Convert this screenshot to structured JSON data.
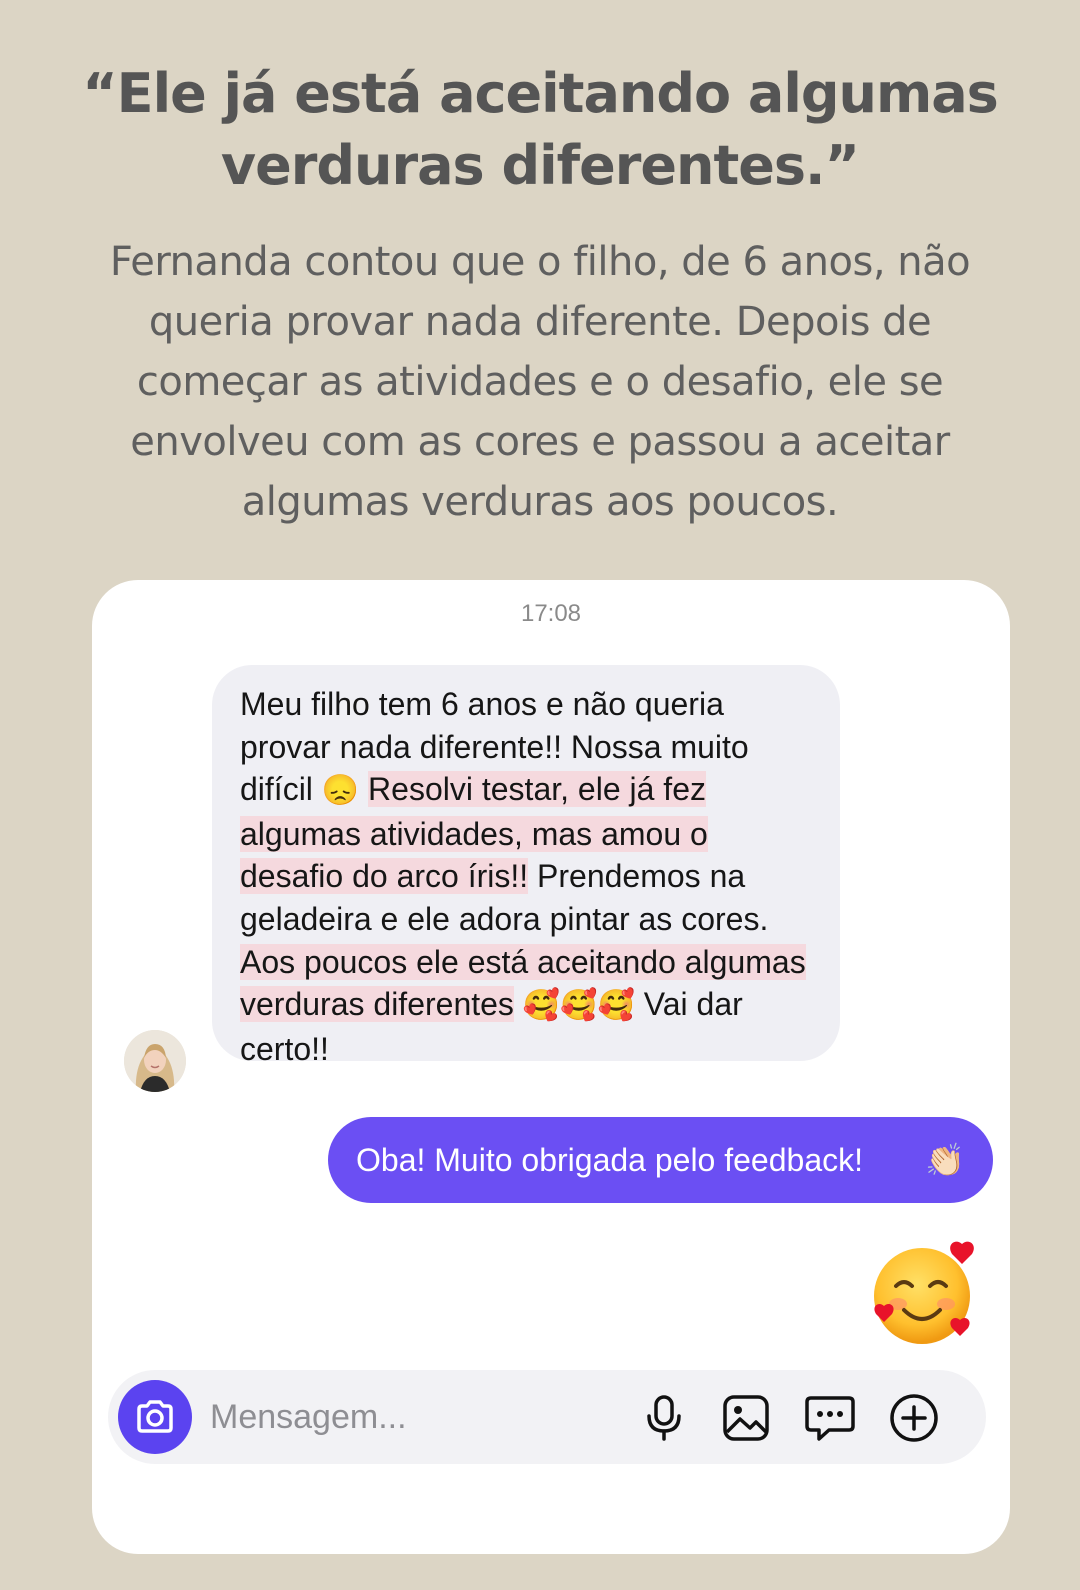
{
  "header": {
    "title_line1": "“Ele já está aceitando algumas",
    "title_line2": "verduras diferentes.”",
    "subtitle_lines": [
      "Fernanda contou que o filho, de 6 anos, não",
      "queria provar nada diferente. Depois de",
      "começar as atividades e o desafio, ele se",
      "envolveu com as cores e passou a aceitar",
      "algumas verduras aos poucos."
    ]
  },
  "chat": {
    "timestamp": "17:08",
    "incoming": {
      "seg1": "Meu filho tem 6 anos e não queria",
      "seg2": "provar nada diferente!! Nossa muito",
      "seg3": "difícil",
      "emoji_sad": "😞",
      "hl1": "Resolvi testar, ele já fez",
      "hl2": "algumas atividades, mas amou o",
      "hl3": "desafio do arco íris!!",
      "seg4": " Prendemos na",
      "seg5": "geladeira e ele adora pintar as cores.",
      "hl4": "Aos poucos ele está aceitando algumas",
      "hl5": "verduras diferentes",
      "emoji_love": "🥰🥰🥰",
      "seg6": " Vai dar",
      "seg7": "certo!!"
    },
    "outgoing": {
      "text": "Oba! Muito obrigada pelo feedback!",
      "emoji": "👏🏻"
    },
    "reaction_icon": "smiling-face-with-hearts-icon",
    "composer": {
      "placeholder": "Mensagem...",
      "icons": [
        "camera-icon",
        "microphone-icon",
        "image-icon",
        "chat-bubble-icon",
        "plus-circle-icon"
      ]
    }
  },
  "colors": {
    "background": "#dcd5c5",
    "accent": "#6b4ff3",
    "highlight": "#f5d9de"
  }
}
